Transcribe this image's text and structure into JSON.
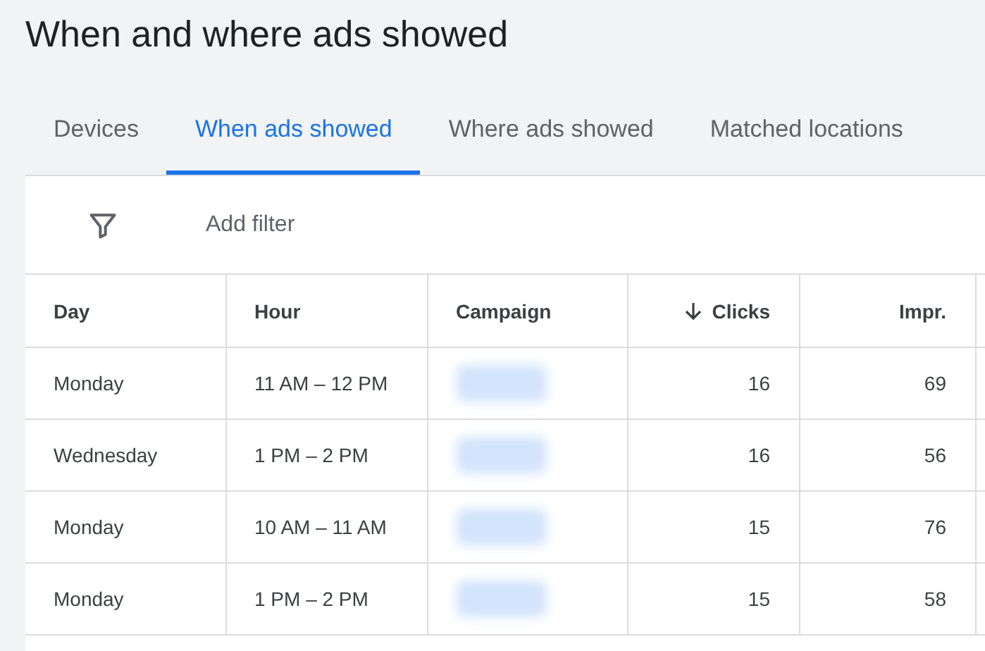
{
  "page": {
    "title": "When and where ads showed"
  },
  "tabs": [
    {
      "label": "Devices",
      "selected": false
    },
    {
      "label": "When ads showed",
      "selected": true
    },
    {
      "label": "Where ads showed",
      "selected": false
    },
    {
      "label": "Matched locations",
      "selected": false
    }
  ],
  "filter": {
    "label": "Add filter"
  },
  "table": {
    "columns": [
      {
        "label": "Day",
        "kind": "text",
        "sorted": false
      },
      {
        "label": "Hour",
        "kind": "text",
        "sorted": false
      },
      {
        "label": "Campaign",
        "kind": "blurred",
        "sorted": false
      },
      {
        "label": "Clicks",
        "kind": "number",
        "sorted": true
      },
      {
        "label": "Impr.",
        "kind": "number",
        "sorted": false
      }
    ],
    "rows": [
      [
        "Monday",
        "11 AM – 12 PM",
        "",
        "16",
        "69"
      ],
      [
        "Wednesday",
        "1 PM – 2 PM",
        "",
        "16",
        "56"
      ],
      [
        "Monday",
        "10 AM – 11 AM",
        "",
        "15",
        "76"
      ],
      [
        "Monday",
        "1 PM – 2 PM",
        "",
        "15",
        "58"
      ]
    ]
  }
}
